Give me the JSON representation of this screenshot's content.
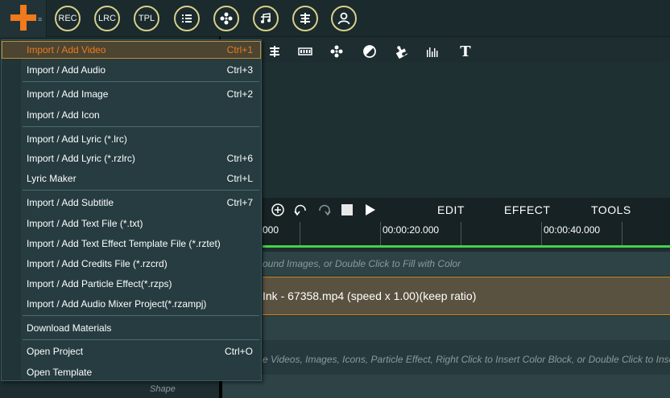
{
  "toolbar": {
    "buttons": [
      {
        "label": "REC"
      },
      {
        "label": "LRC"
      },
      {
        "label": "TPL"
      },
      {
        "icon": "list-icon"
      },
      {
        "icon": "flower-icon"
      },
      {
        "icon": "music-notes-icon"
      },
      {
        "icon": "align-icon"
      },
      {
        "icon": "user-icon"
      }
    ]
  },
  "transport": {
    "tabs": [
      "EDIT",
      "EFFECT",
      "TOOLS"
    ]
  },
  "ruler": {
    "labels": [
      "000",
      "00:00:20.000",
      "00:00:40.000"
    ]
  },
  "tracks": {
    "background_hint": "ound Images, or Double Click to Fill with Color",
    "video_clip": "Ink - 67358.mp4  (speed x 1.00)(keep ratio)",
    "main_hint": "e Videos, Images, Icons, Particle Effect, Right Click to Insert Color Block, or Double  Click to Inse"
  },
  "left_panel": {
    "shape_label": "Shape"
  },
  "menu": {
    "items": [
      {
        "label": "Import / Add Video",
        "shortcut": "Ctrl+1"
      },
      {
        "label": "Import / Add Audio",
        "shortcut": "Ctrl+3"
      },
      {
        "label": "Import / Add Image",
        "shortcut": "Ctrl+2"
      },
      {
        "label": "Import / Add Icon",
        "shortcut": ""
      },
      {
        "label": "Import / Add Lyric (*.lrc)",
        "shortcut": ""
      },
      {
        "label": "Import / Add Lyric (*.rzlrc)",
        "shortcut": "Ctrl+6"
      },
      {
        "label": "Lyric Maker",
        "shortcut": "Ctrl+L"
      },
      {
        "label": "Import / Add Subtitle",
        "shortcut": "Ctrl+7"
      },
      {
        "label": "Import / Add Text File (*.txt)",
        "shortcut": ""
      },
      {
        "label": "Import / Add Text Effect Template File (*.rztet)",
        "shortcut": ""
      },
      {
        "label": "Import / Add Credits File (*.rzcrd)",
        "shortcut": ""
      },
      {
        "label": "Import / Add Particle Effect(*.rzps)",
        "shortcut": ""
      },
      {
        "label": "Import / Add Audio Mixer Project(*.rzampj)",
        "shortcut": ""
      },
      {
        "label": "Download Materials",
        "shortcut": ""
      },
      {
        "label": "Open Project",
        "shortcut": "Ctrl+O"
      },
      {
        "label": "Open Template",
        "shortcut": ""
      }
    ]
  },
  "colors": {
    "accent": "#f07a1c",
    "toolbar_ring": "#d7d08a",
    "timeline_progress": "#44d248",
    "selection_border": "#c88a2a"
  }
}
